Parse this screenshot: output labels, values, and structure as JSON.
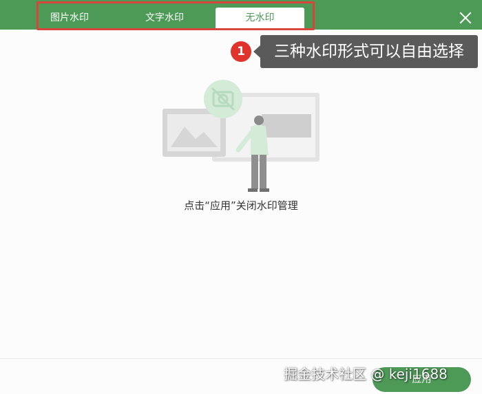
{
  "tabs": [
    {
      "label": "图片水印"
    },
    {
      "label": "文字水印"
    },
    {
      "label": "无水印"
    }
  ],
  "annotation": {
    "step": "1",
    "text": "三种水印形式可以自由选择"
  },
  "main": {
    "hint": "点击“应用”关闭水印管理"
  },
  "footer": {
    "apply_label": "应用"
  },
  "watermark": {
    "text": "掘金技术社区 @ keji1688"
  },
  "colors": {
    "accent": "#4d9a57",
    "highlight": "#d9443c",
    "badge": "#e0332c"
  }
}
